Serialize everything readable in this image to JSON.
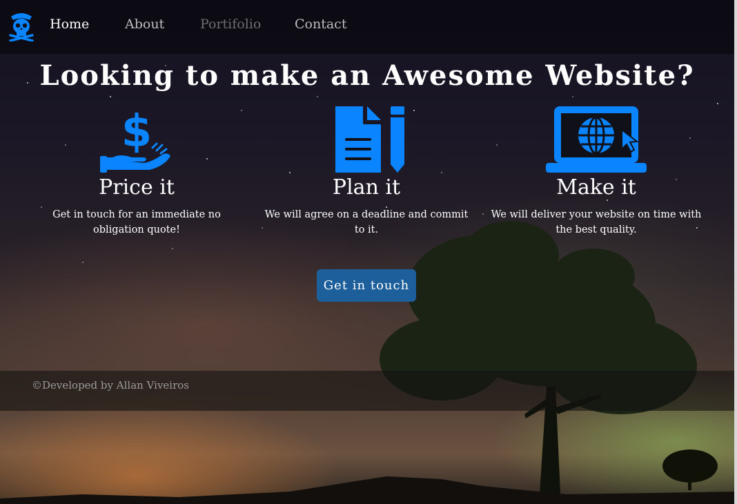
{
  "nav": {
    "links": [
      {
        "label": "Home",
        "state": "active"
      },
      {
        "label": "About",
        "state": "default"
      },
      {
        "label": "Portifolio",
        "state": "dim"
      },
      {
        "label": "Contact",
        "state": "default"
      }
    ]
  },
  "hero": {
    "headline": "Looking to make an Awesome Website?"
  },
  "features": [
    {
      "icon": "hand-dollar-icon",
      "title": "Price it",
      "description": "Get in touch for an immediate no obligation quote!"
    },
    {
      "icon": "document-pencil-icon",
      "title": "Plan it",
      "description": "We will agree on a deadline and commit to it."
    },
    {
      "icon": "laptop-globe-icon",
      "title": "Make it",
      "description": "We will deliver your website on time with the best quality."
    }
  ],
  "cta": {
    "label": "Get in touch"
  },
  "footer": {
    "text": "©Developed by Allan Viveiros"
  },
  "colors": {
    "accent": "#0a84ff",
    "button": "#1c5f9a",
    "nav_text": "#bdbdbd",
    "footer_text": "#9a9a9a"
  }
}
